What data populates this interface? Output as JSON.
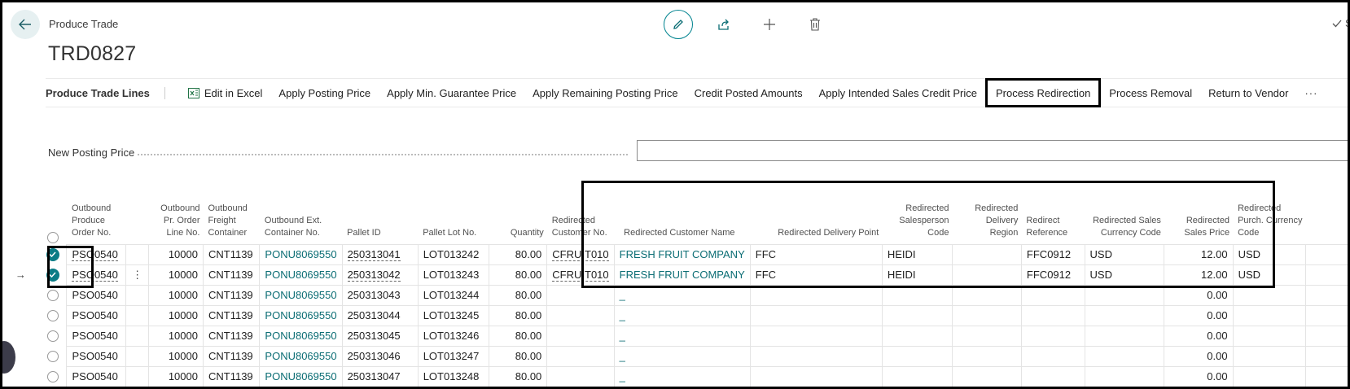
{
  "header": {
    "breadcrumb": "Produce Trade",
    "title": "TRD0827",
    "saved_label": "S"
  },
  "actions": {
    "section_title": "Produce Trade Lines",
    "items": [
      {
        "label": "Edit in Excel"
      },
      {
        "label": "Apply Posting Price"
      },
      {
        "label": "Apply Min. Guarantee Price"
      },
      {
        "label": "Apply Remaining Posting Price"
      },
      {
        "label": "Credit Posted Amounts"
      },
      {
        "label": "Apply Intended Sales Credit Price"
      },
      {
        "label": "Process Redirection"
      },
      {
        "label": "Process Removal"
      },
      {
        "label": "Return to Vendor"
      }
    ],
    "more": "···"
  },
  "form": {
    "new_posting_price_label": "New Posting Price",
    "new_posting_price_value": ""
  },
  "table": {
    "headers": {
      "order_no": "Outbound Produce Order No.",
      "line_no": "Outbound Pr. Order Line No.",
      "freight": "Outbound Freight Container",
      "ext_container": "Outbound Ext. Container No.",
      "pallet_id": "Pallet ID",
      "pallet_lot": "Pallet Lot No.",
      "quantity": "Quantity",
      "redir_cust_no": "Redirected Customer No.",
      "redir_cust_name": "Redirected Customer Name",
      "redir_delivery_point": "Redirected Delivery Point",
      "redir_salesperson": "Redirected Salesperson Code",
      "redir_region": "Redirected Delivery Region",
      "redir_reference": "Redirect Reference",
      "redir_currency": "Redirected Sales Currency Code",
      "redir_price": "Redirected Sales Price",
      "redir_purch_currency": "Redirected Purch. Currency Code"
    },
    "rows": [
      {
        "selected": true,
        "current": false,
        "order_no": "PSO0540",
        "line_no": "10000",
        "freight": "CNT1139",
        "ext_container": "PONU8069550",
        "pallet_id": "250313041",
        "pallet_lot": "LOT013242",
        "quantity": "80.00",
        "cust_no": "CFRUIT010",
        "cust_name": "FRESH FRUIT COMPANY",
        "delivery_point": "FFC",
        "salesperson": "HEIDI",
        "region": "",
        "reference": "FFC0912",
        "currency": "USD",
        "price": "12.00",
        "purch_currency": "USD"
      },
      {
        "selected": true,
        "current": true,
        "current_marker": "→",
        "row_menu": "⋮",
        "order_no": "PSO0540",
        "line_no": "10000",
        "freight": "CNT1139",
        "ext_container": "PONU8069550",
        "pallet_id": "250313042",
        "pallet_lot": "LOT013243",
        "quantity": "80.00",
        "cust_no": "CFRUIT010",
        "cust_name": "FRESH FRUIT COMPANY",
        "delivery_point": "FFC",
        "salesperson": "HEIDI",
        "region": "",
        "reference": "FFC0912",
        "currency": "USD",
        "price": "12.00",
        "purch_currency": "USD"
      },
      {
        "selected": false,
        "current": false,
        "order_no": "PSO0540",
        "line_no": "10000",
        "freight": "CNT1139",
        "ext_container": "PONU8069550",
        "pallet_id": "250313043",
        "pallet_lot": "LOT013244",
        "quantity": "80.00",
        "cust_no": "",
        "cust_name": "_",
        "delivery_point": "",
        "salesperson": "",
        "region": "",
        "reference": "",
        "currency": "",
        "price": "0.00",
        "purch_currency": ""
      },
      {
        "selected": false,
        "current": false,
        "order_no": "PSO0540",
        "line_no": "10000",
        "freight": "CNT1139",
        "ext_container": "PONU8069550",
        "pallet_id": "250313044",
        "pallet_lot": "LOT013245",
        "quantity": "80.00",
        "cust_no": "",
        "cust_name": "_",
        "delivery_point": "",
        "salesperson": "",
        "region": "",
        "reference": "",
        "currency": "",
        "price": "0.00",
        "purch_currency": ""
      },
      {
        "selected": false,
        "current": false,
        "order_no": "PSO0540",
        "line_no": "10000",
        "freight": "CNT1139",
        "ext_container": "PONU8069550",
        "pallet_id": "250313045",
        "pallet_lot": "LOT013246",
        "quantity": "80.00",
        "cust_no": "",
        "cust_name": "_",
        "delivery_point": "",
        "salesperson": "",
        "region": "",
        "reference": "",
        "currency": "",
        "price": "0.00",
        "purch_currency": ""
      },
      {
        "selected": false,
        "current": false,
        "order_no": "PSO0540",
        "line_no": "10000",
        "freight": "CNT1139",
        "ext_container": "PONU8069550",
        "pallet_id": "250313046",
        "pallet_lot": "LOT013247",
        "quantity": "80.00",
        "cust_no": "",
        "cust_name": "_",
        "delivery_point": "",
        "salesperson": "",
        "region": "",
        "reference": "",
        "currency": "",
        "price": "0.00",
        "purch_currency": ""
      },
      {
        "selected": false,
        "current": false,
        "order_no": "PSO0540",
        "line_no": "10000",
        "freight": "CNT1139",
        "ext_container": "PONU8069550",
        "pallet_id": "250313047",
        "pallet_lot": "LOT013248",
        "quantity": "80.00",
        "cust_no": "",
        "cust_name": "_",
        "delivery_point": "",
        "salesperson": "",
        "region": "",
        "reference": "",
        "currency": "",
        "price": "0.00",
        "purch_currency": ""
      }
    ]
  },
  "colors": {
    "accent": "#0b7c86",
    "link": "#0b6d74"
  }
}
